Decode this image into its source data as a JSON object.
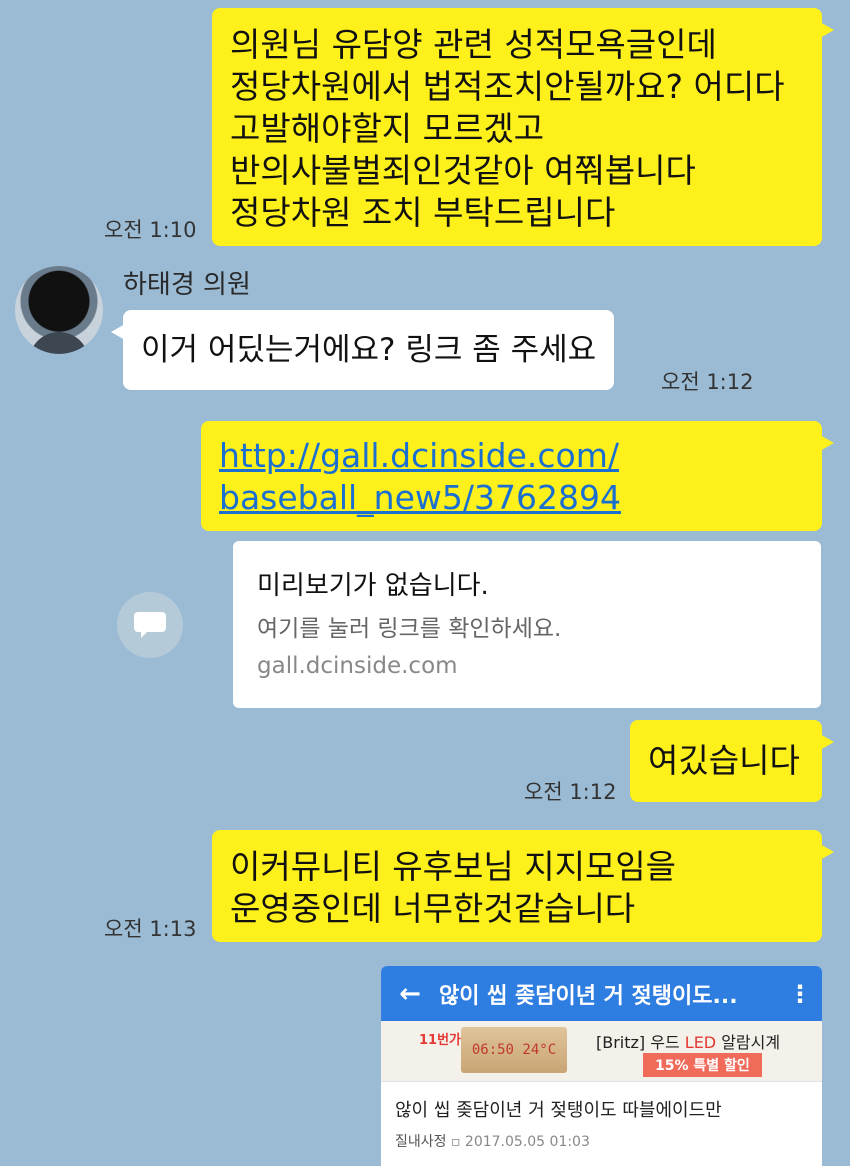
{
  "messages": {
    "m1": {
      "lines": [
        "의원님 유담양 관련 성적모욕글인데",
        "정당차원에서 법적조치안될까요? 어디다",
        "고발해야할지 모르겠고",
        "반의사불벌죄인것같아 여쭤봅니다",
        "정당차원 조치 부탁드립니다"
      ],
      "time": "오전 1:10"
    },
    "m2": {
      "sender": "하태경 의원",
      "text": "이거 어딨는거에요? 링크 좀 주세요",
      "time": "오전 1:12"
    },
    "m3": {
      "lines": [
        "http://gall.dcinside.com/",
        "baseball_new5/3762894"
      ]
    },
    "m4": {
      "title": "미리보기가 없습니다.",
      "subtitle": "여기를 눌러 링크를 확인하세요.",
      "domain": "gall.dcinside.com"
    },
    "m5": {
      "text": "여깄습니다",
      "time": "오전 1:12"
    },
    "m6": {
      "lines": [
        "이커뮤니티 유후보님 지지모임을",
        "운영중인데 너무한것같습니다"
      ],
      "time": "오전 1:13"
    }
  },
  "image_card": {
    "back_icon": "←",
    "header_title": "않이 씹 좆담이년 거 젖탱이도...",
    "more_icon": "⋮",
    "ad": {
      "logo": "11번가",
      "clock_display": "06:50  24°C",
      "product_prefix": "[Britz] 우드 ",
      "product_led": "LED",
      "product_suffix": " 알람시계",
      "badge": "15% 특별 할인"
    },
    "post_title": "않이 씹 좆담이년 거 젖탱이도 따블에이드만",
    "post_author": "질내사정",
    "post_date": "2017.05.05 01:03"
  },
  "colors": {
    "background": "#9bbbd4",
    "my_bubble": "#fef01b",
    "other_bubble": "#ffffff",
    "link": "#1a6fd1",
    "image_header": "#2e7de1"
  },
  "icons": {
    "avatar": "profile-photo",
    "share": "speech-bubble-icon"
  }
}
